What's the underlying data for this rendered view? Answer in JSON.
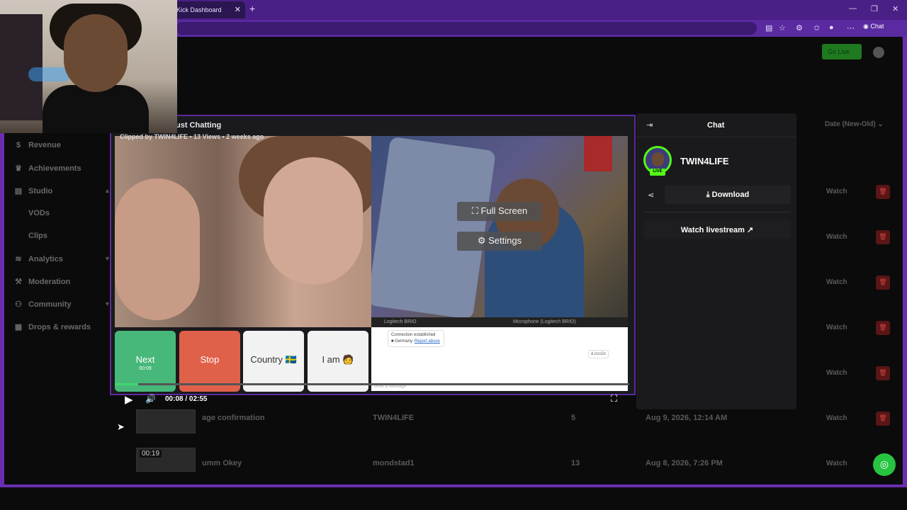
{
  "browser": {
    "tab_title": "Kick Dashboard",
    "tab_close": "✕",
    "new_tab": "+",
    "chat_button": "Chat"
  },
  "header": {
    "go_live": "Go Live"
  },
  "sidebar": {
    "items": [
      {
        "label": "Revenue",
        "icon": "$"
      },
      {
        "label": "Achievements",
        "icon": "♛"
      },
      {
        "label": "Studio",
        "icon": "▤"
      },
      {
        "label": "VODs"
      },
      {
        "label": "Clips"
      },
      {
        "label": "Analytics",
        "icon": "≋"
      },
      {
        "label": "Moderation",
        "icon": "⚒"
      },
      {
        "label": "Community",
        "icon": "⚇"
      },
      {
        "label": "Drops & rewards",
        "icon": "▦"
      }
    ]
  },
  "table": {
    "sort_label": "Date (New-Old)",
    "watch_label": "Watch",
    "rows": [
      {
        "title": "age confirmation",
        "clipper": "TWIN4LIFE",
        "views": "5",
        "date": "Aug 9, 2026, 12:14 AM"
      },
      {
        "title": "umm Okey",
        "clipper": "mondstad1",
        "views": "13",
        "date": "Aug 8, 2026, 7:26 PM",
        "duration": "00:19"
      }
    ]
  },
  "clip": {
    "category": "ust Chatting",
    "meta": "Clipped by TWIN4LIFE • 13 Views • 2 weeks ago",
    "fullscreen_label": "Full Screen",
    "settings_label": "Settings",
    "timecode": "00:08 / 02:55",
    "progress_fraction": 0.046,
    "ome": {
      "camera_select": "Logitech BRIO",
      "mic_select": "Microphone (Logitech BRIO)",
      "connection_text": "Connection established",
      "country_text": "Germany",
      "report_link": "Report abuse",
      "nickname": "d.rico2x",
      "message_placeholder": "Write a message",
      "next_label": "Next",
      "next_timer": "00:09",
      "stop_label": "Stop",
      "country_label": "Country 🇸🇪",
      "iam_label": "I am 🧑"
    }
  },
  "chat_panel": {
    "title": "Chat",
    "streamer": "TWIN4LIFE",
    "live_badge": "LIVE",
    "download_label": "Download",
    "watch_livestream_label": "Watch livestream"
  },
  "colors": {
    "accent": "#53fc18",
    "browser_purple": "#4a1f86"
  }
}
